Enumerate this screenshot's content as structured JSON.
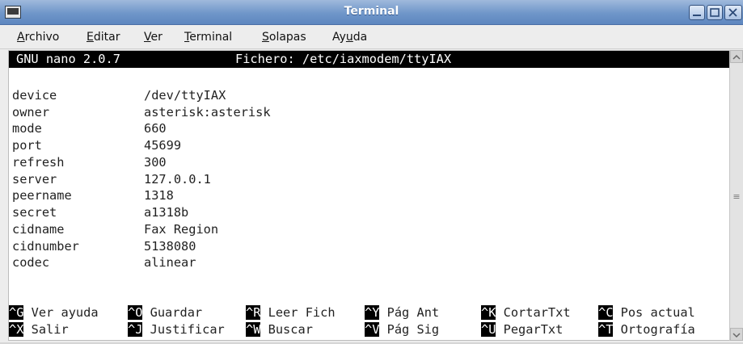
{
  "window": {
    "title": "Terminal"
  },
  "menu": [
    {
      "mnemonic": "A",
      "rest": "rchivo"
    },
    {
      "mnemonic": "E",
      "rest": "ditar"
    },
    {
      "mnemonic": "V",
      "rest": "er"
    },
    {
      "mnemonic": "T",
      "rest": "erminal"
    },
    {
      "mnemonic": "S",
      "rest": "olapas"
    },
    {
      "pre": "Ay",
      "mnemonic": "u",
      "rest": "da"
    }
  ],
  "nano": {
    "version": "GNU nano 2.0.7",
    "file_label": "Fichero: /etc/iaxmodem/ttyIAX"
  },
  "config": [
    {
      "key": "device",
      "value": "/dev/ttyIAX"
    },
    {
      "key": "owner",
      "value": "asterisk:asterisk"
    },
    {
      "key": "mode",
      "value": "660"
    },
    {
      "key": "port",
      "value": "45699"
    },
    {
      "key": "refresh",
      "value": "300"
    },
    {
      "key": "server",
      "value": "127.0.0.1"
    },
    {
      "key": "peername",
      "value": "1318"
    },
    {
      "key": "secret",
      "value": "a1318b"
    },
    {
      "key": "cidname",
      "value": "Fax Region"
    },
    {
      "key": "cidnumber",
      "value": "5138080"
    },
    {
      "key": "codec",
      "value": "alinear"
    }
  ],
  "shortcuts_row1": [
    {
      "key": "^G",
      "label": "Ver ayuda"
    },
    {
      "key": "^O",
      "label": "Guardar"
    },
    {
      "key": "^R",
      "label": "Leer Fich"
    },
    {
      "key": "^Y",
      "label": "Pág Ant"
    },
    {
      "key": "^K",
      "label": "CortarTxt"
    },
    {
      "key": "^C",
      "label": "Pos actual"
    }
  ],
  "shortcuts_row2": [
    {
      "key": "^X",
      "label": "Salir"
    },
    {
      "key": "^J",
      "label": "Justificar"
    },
    {
      "key": "^W",
      "label": "Buscar"
    },
    {
      "key": "^V",
      "label": "Pág Sig"
    },
    {
      "key": "^U",
      "label": "PegarTxt"
    },
    {
      "key": "^T",
      "label": "Ortografía"
    }
  ],
  "icons": {
    "app": "terminal-icon",
    "minimize": "minimize-icon",
    "maximize": "maximize-icon",
    "close": "close-icon",
    "scroll_up": "chevron-up-icon",
    "scroll_down": "chevron-down-icon"
  },
  "colors": {
    "titlebar": "#6f96c9",
    "terminal_bg": "#ffffff",
    "nano_bar": "#000000"
  }
}
